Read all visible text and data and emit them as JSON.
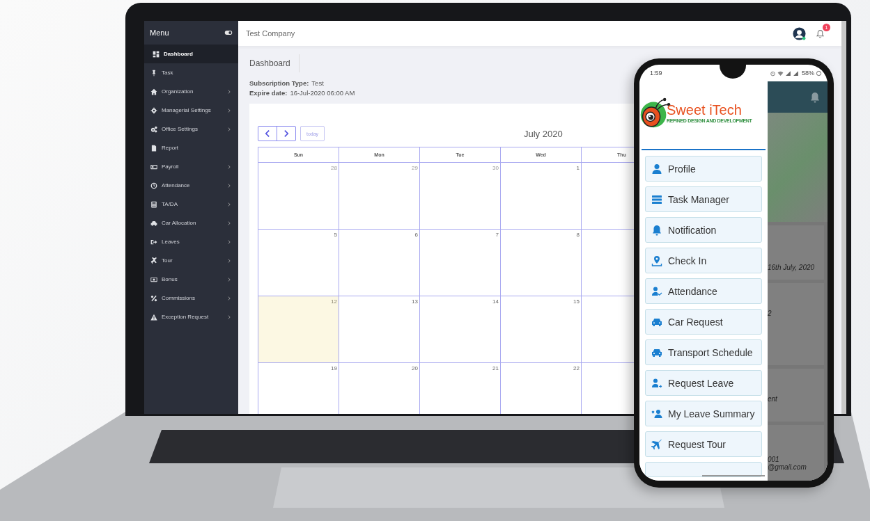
{
  "laptop": {
    "sidebar": {
      "title": "Menu",
      "items": [
        {
          "label": "Dashboard",
          "selected": true,
          "has_submenu": false
        },
        {
          "label": "Task",
          "selected": false,
          "has_submenu": false
        },
        {
          "label": "Organization",
          "selected": false,
          "has_submenu": true
        },
        {
          "label": "Managerial Settings",
          "selected": false,
          "has_submenu": true
        },
        {
          "label": "Office Settings",
          "selected": false,
          "has_submenu": true
        },
        {
          "label": "Report",
          "selected": false,
          "has_submenu": false
        },
        {
          "label": "Payroll",
          "selected": false,
          "has_submenu": true
        },
        {
          "label": "Attendance",
          "selected": false,
          "has_submenu": true
        },
        {
          "label": "TA/DA",
          "selected": false,
          "has_submenu": true
        },
        {
          "label": "Car Allocation",
          "selected": false,
          "has_submenu": true
        },
        {
          "label": "Leaves",
          "selected": false,
          "has_submenu": true
        },
        {
          "label": "Tour",
          "selected": false,
          "has_submenu": true
        },
        {
          "label": "Bonus",
          "selected": false,
          "has_submenu": true
        },
        {
          "label": "Commissions",
          "selected": false,
          "has_submenu": true
        },
        {
          "label": "Exception Request",
          "selected": false,
          "has_submenu": true
        }
      ]
    },
    "topbar": {
      "company": "Test Company",
      "notification_count": "1"
    },
    "page": {
      "title": "Dashboard",
      "details": [
        {
          "label": "Subscription Type:",
          "value": "Test"
        },
        {
          "label": "Expire date:",
          "value": "16-Jul-2020 06:00 AM"
        }
      ]
    },
    "calendar": {
      "title": "July 2020",
      "today_button": "today",
      "columns": [
        "Sun",
        "Mon",
        "Tue",
        "Wed",
        "Thu"
      ],
      "weeks": [
        [
          {
            "day": "28",
            "other_month": true,
            "today": false
          },
          {
            "day": "29",
            "other_month": true,
            "today": false
          },
          {
            "day": "30",
            "other_month": true,
            "today": false
          },
          {
            "day": "1",
            "other_month": false,
            "today": false
          }
        ],
        [
          {
            "day": "5",
            "other_month": false,
            "today": false
          },
          {
            "day": "6",
            "other_month": false,
            "today": false
          },
          {
            "day": "7",
            "other_month": false,
            "today": false
          },
          {
            "day": "8",
            "other_month": false,
            "today": false
          }
        ],
        [
          {
            "day": "12",
            "other_month": false,
            "today": true
          },
          {
            "day": "13",
            "other_month": false,
            "today": false
          },
          {
            "day": "14",
            "other_month": false,
            "today": false
          },
          {
            "day": "15",
            "other_month": false,
            "today": false
          }
        ],
        [
          {
            "day": "19",
            "other_month": false,
            "today": false
          },
          {
            "day": "20",
            "other_month": false,
            "today": false
          },
          {
            "day": "21",
            "other_month": false,
            "today": false
          },
          {
            "day": "22",
            "other_month": false,
            "today": false
          }
        ]
      ]
    }
  },
  "phone": {
    "status_bar": {
      "time": "1:59",
      "battery": "58%"
    },
    "logo": {
      "name": "Sweet iTech",
      "tagline": "REFINED DESIGN AND DEVELOPMENT"
    },
    "menu": [
      {
        "label": "Profile"
      },
      {
        "label": "Task Manager"
      },
      {
        "label": "Notification"
      },
      {
        "label": "Check In"
      },
      {
        "label": "Attendance"
      },
      {
        "label": "Car Request"
      },
      {
        "label": "Transport Schedule"
      },
      {
        "label": "Request Leave"
      },
      {
        "label": "My Leave Summary"
      },
      {
        "label": "Request Tour"
      }
    ],
    "background_cards": [
      {
        "lines": [
          "16th July, 2020"
        ]
      },
      {
        "lines": [
          "2"
        ]
      },
      {
        "lines": [
          "ent"
        ]
      },
      {
        "lines": [
          "001",
          "@gmail.com"
        ]
      }
    ]
  }
}
